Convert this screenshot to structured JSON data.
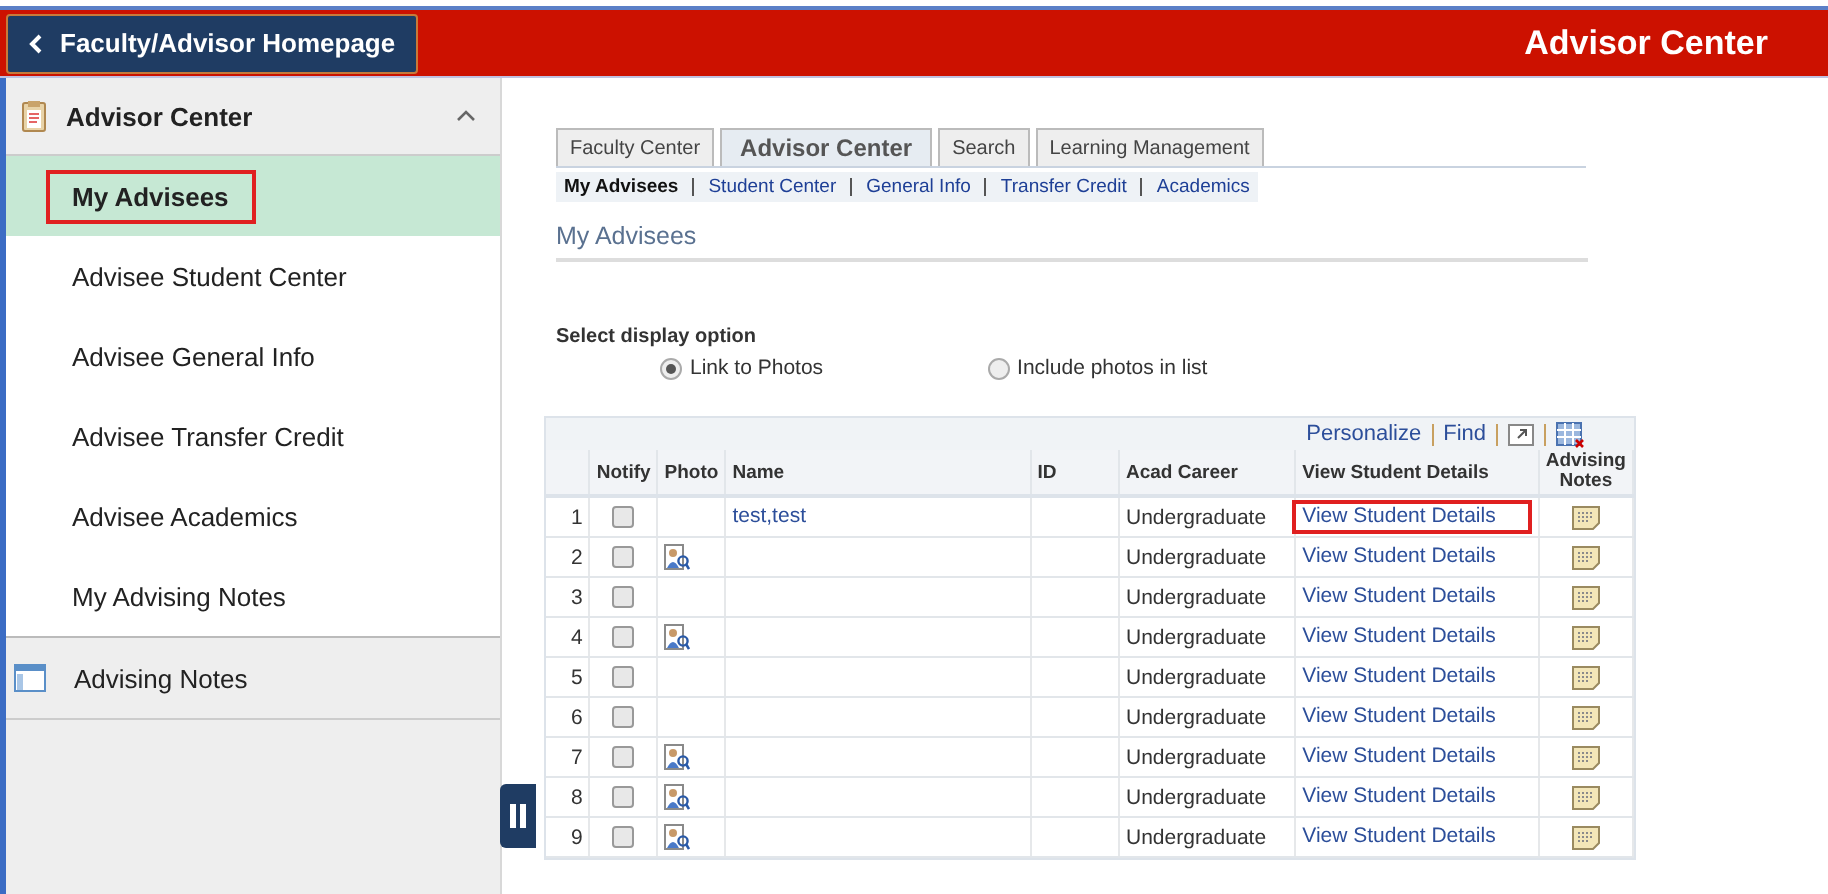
{
  "header": {
    "back_button": "Faculty/Advisor Homepage",
    "title": "Advisor Center"
  },
  "sidebar": {
    "section": {
      "title": "Advisor Center",
      "expanded": true
    },
    "items": [
      {
        "label": "My Advisees",
        "selected": true,
        "annotated": true
      },
      {
        "label": "Advisee Student Center",
        "selected": false,
        "annotated": false
      },
      {
        "label": "Advisee General Info",
        "selected": false,
        "annotated": false
      },
      {
        "label": "Advisee Transfer Credit",
        "selected": false,
        "annotated": false
      },
      {
        "label": "Advisee Academics",
        "selected": false,
        "annotated": false
      },
      {
        "label": "My Advising Notes",
        "selected": false,
        "annotated": false
      }
    ],
    "section_2": {
      "title": "Advising Notes"
    }
  },
  "tabs": [
    {
      "label": "Faculty Center",
      "selected": false
    },
    {
      "label": "Advisor Center",
      "selected": true
    },
    {
      "label": "Search",
      "selected": false
    },
    {
      "label": "Learning Management",
      "selected": false
    }
  ],
  "subnav": [
    {
      "label": "My Advisees",
      "selected": true
    },
    {
      "label": "Student Center",
      "selected": false
    },
    {
      "label": "General Info",
      "selected": false
    },
    {
      "label": "Transfer Credit",
      "selected": false
    },
    {
      "label": "Academics",
      "selected": false
    }
  ],
  "page_title": "My Advisees",
  "display_option": {
    "label": "Select display option",
    "options": [
      {
        "label": "Link to Photos",
        "selected": true
      },
      {
        "label": "Include photos in list",
        "selected": false
      }
    ]
  },
  "grid": {
    "toolbar": [
      "Personalize",
      "Find"
    ],
    "columns": [
      "Notify",
      "Photo",
      "Name",
      "ID",
      "Acad Career",
      "View Student Details",
      "Advising Notes"
    ],
    "rows": [
      {
        "num": "1",
        "notify": false,
        "photo": false,
        "name": "test,test",
        "career": "Undergraduate",
        "link": "View Student Details",
        "annotated": true
      },
      {
        "num": "2",
        "notify": false,
        "photo": true,
        "career": "Undergraduate",
        "link": "View Student Details",
        "annotated": false
      },
      {
        "num": "3",
        "notify": false,
        "photo": false,
        "career": "Undergraduate",
        "link": "View Student Details",
        "annotated": false
      },
      {
        "num": "4",
        "notify": false,
        "photo": true,
        "career": "Undergraduate",
        "link": "View Student Details",
        "annotated": false
      },
      {
        "num": "5",
        "notify": false,
        "photo": false,
        "career": "Undergraduate",
        "link": "View Student Details",
        "annotated": false
      },
      {
        "num": "6",
        "notify": false,
        "photo": false,
        "career": "Undergraduate",
        "link": "View Student Details",
        "annotated": false
      },
      {
        "num": "7",
        "notify": false,
        "photo": true,
        "career": "Undergraduate",
        "link": "View Student Details",
        "annotated": false
      },
      {
        "num": "8",
        "notify": false,
        "photo": true,
        "career": "Undergraduate",
        "link": "View Student Details",
        "annotated": false
      },
      {
        "num": "9",
        "notify": false,
        "photo": true,
        "career": "Undergraduate",
        "link": "View Student Details",
        "annotated": false
      }
    ]
  }
}
